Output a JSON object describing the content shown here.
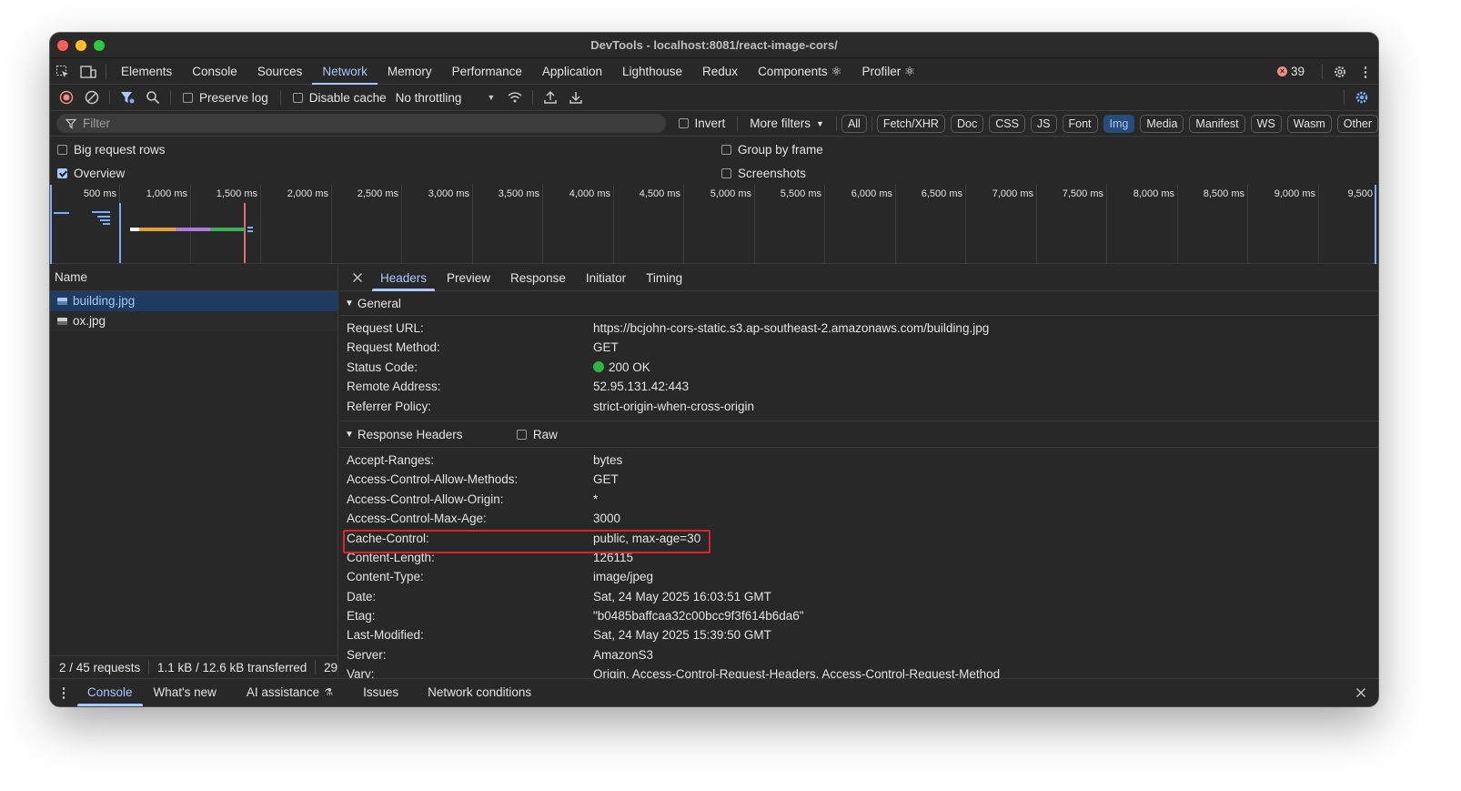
{
  "window": {
    "title": "DevTools - localhost:8081/react-image-cors/"
  },
  "main_tabs": [
    "Elements",
    "Console",
    "Sources",
    "Network",
    "Memory",
    "Performance",
    "Application",
    "Lighthouse",
    "Redux",
    "Components ⚛",
    "Profiler ⚛"
  ],
  "errors": {
    "count": "39"
  },
  "toolbar": {
    "preserve_log": "Preserve log",
    "disable_cache": "Disable cache",
    "throttling": "No throttling"
  },
  "filter": {
    "placeholder": "Filter",
    "invert": "Invert",
    "more_filters": "More filters",
    "types": [
      "All",
      "Fetch/XHR",
      "Doc",
      "CSS",
      "JS",
      "Font",
      "Img",
      "Media",
      "Manifest",
      "WS",
      "Wasm",
      "Other"
    ],
    "active_type": "Img"
  },
  "options": {
    "big_rows": "Big request rows",
    "overview": "Overview",
    "group_by_frame": "Group by frame",
    "screenshots": "Screenshots"
  },
  "timeline": {
    "ticks": [
      "500 ms",
      "1,000 ms",
      "1,500 ms",
      "2,000 ms",
      "2,500 ms",
      "3,000 ms",
      "3,500 ms",
      "4,000 ms",
      "4,500 ms",
      "5,000 ms",
      "5,500 ms",
      "6,000 ms",
      "6,500 ms",
      "7,000 ms",
      "7,500 ms",
      "8,000 ms",
      "8,500 ms",
      "9,000 ms",
      "9,500"
    ]
  },
  "requests": {
    "header": "Name",
    "items": [
      "building.jpg",
      "ox.jpg"
    ],
    "status": "2 / 45 requests",
    "transfer": "1.1 kB / 12.6 kB transferred",
    "more": "29"
  },
  "detail_tabs": [
    "Headers",
    "Preview",
    "Response",
    "Initiator",
    "Timing"
  ],
  "general": {
    "title": "General",
    "rows": [
      {
        "k": "Request URL:",
        "v": "https://bcjohn-cors-static.s3.ap-southeast-2.amazonaws.com/building.jpg"
      },
      {
        "k": "Request Method:",
        "v": "GET"
      },
      {
        "k": "Status Code:",
        "v": "200 OK"
      },
      {
        "k": "Remote Address:",
        "v": "52.95.131.42:443"
      },
      {
        "k": "Referrer Policy:",
        "v": "strict-origin-when-cross-origin"
      }
    ]
  },
  "response_headers": {
    "title": "Response Headers",
    "raw": "Raw",
    "rows": [
      {
        "k": "Accept-Ranges:",
        "v": "bytes"
      },
      {
        "k": "Access-Control-Allow-Methods:",
        "v": "GET"
      },
      {
        "k": "Access-Control-Allow-Origin:",
        "v": "*"
      },
      {
        "k": "Access-Control-Max-Age:",
        "v": "3000"
      },
      {
        "k": "Cache-Control:",
        "v": "public, max-age=30"
      },
      {
        "k": "Content-Length:",
        "v": "126115"
      },
      {
        "k": "Content-Type:",
        "v": "image/jpeg"
      },
      {
        "k": "Date:",
        "v": "Sat, 24 May 2025 16:03:51 GMT"
      },
      {
        "k": "Etag:",
        "v": "\"b0485baffcaa32c00bcc9f3f614b6da6\""
      },
      {
        "k": "Last-Modified:",
        "v": "Sat, 24 May 2025 15:39:50 GMT"
      },
      {
        "k": "Server:",
        "v": "AmazonS3"
      },
      {
        "k": "Vary:",
        "v": "Origin, Access-Control-Request-Headers, Access-Control-Request-Method"
      }
    ]
  },
  "drawer": {
    "tabs": [
      "Console",
      "What's new",
      "AI assistance",
      "Issues",
      "Network conditions"
    ]
  },
  "colors": {
    "accent": "#a8c7fa",
    "status_ok": "#2fb344",
    "highlight": "#d9262b"
  }
}
